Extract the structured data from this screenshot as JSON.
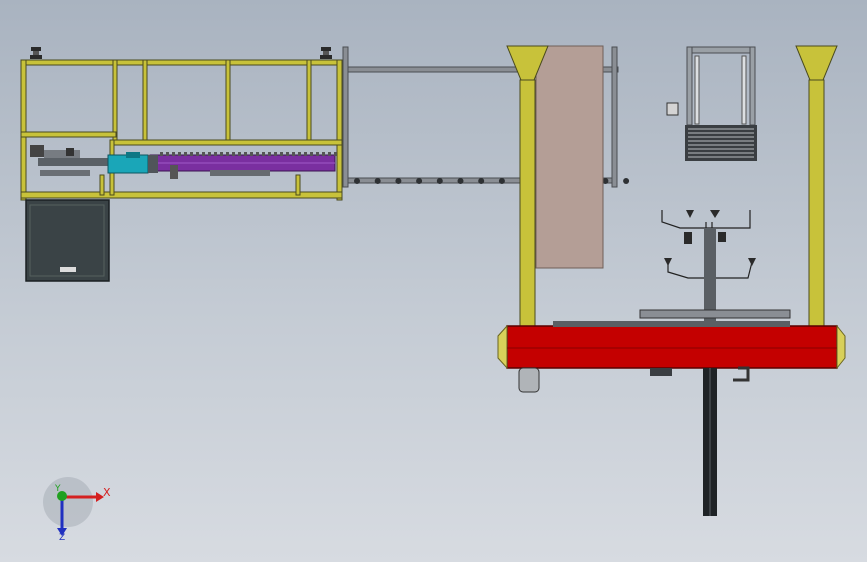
{
  "viewport": {
    "background_top": "#a9b3c0",
    "background_bottom": "#d7dbe1"
  },
  "colors": {
    "frame_yellow": "#c8c23a",
    "frame_outline": "#4a4a1e",
    "conveyor_purple": "#7a2fa0",
    "base_red": "#c40000",
    "panel_gray": "#b49e96",
    "cabinet_dark": "#3a4346",
    "motor_cyan": "#1aa6b8",
    "gray_steel": "#7c8086"
  },
  "triad": {
    "x_label": "X",
    "y_label": "Y",
    "z_label": "Z",
    "x_color": "#d42020",
    "y_color": "#20a020",
    "z_color": "#2030c0"
  }
}
